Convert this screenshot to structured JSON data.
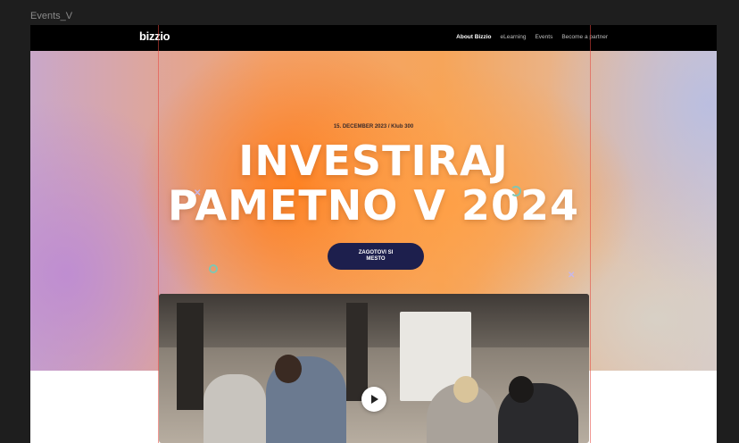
{
  "canvas": {
    "frame_label": "Events_V"
  },
  "navbar": {
    "logo": "bizzio",
    "links": [
      {
        "label": "About Bizzio",
        "active": true
      },
      {
        "label": "eLearning",
        "active": false
      },
      {
        "label": "Events",
        "active": false
      },
      {
        "label": "Become a partner",
        "active": false
      }
    ]
  },
  "hero": {
    "event_meta": "15. DECEMBER 2023 / Klub 300",
    "title_line1": "INVESTIRAJ",
    "title_line2": "PAMETNO V 2024",
    "cta_line1": "ZAGOTOVI SI",
    "cta_line2": "MESTO"
  },
  "video": {
    "icon": "play-icon"
  },
  "colors": {
    "cta_bg": "#1d1f4d",
    "guide": "#e6463c",
    "accent_orange": "#ff7a1a",
    "accent_lilac": "#be8cd2"
  }
}
